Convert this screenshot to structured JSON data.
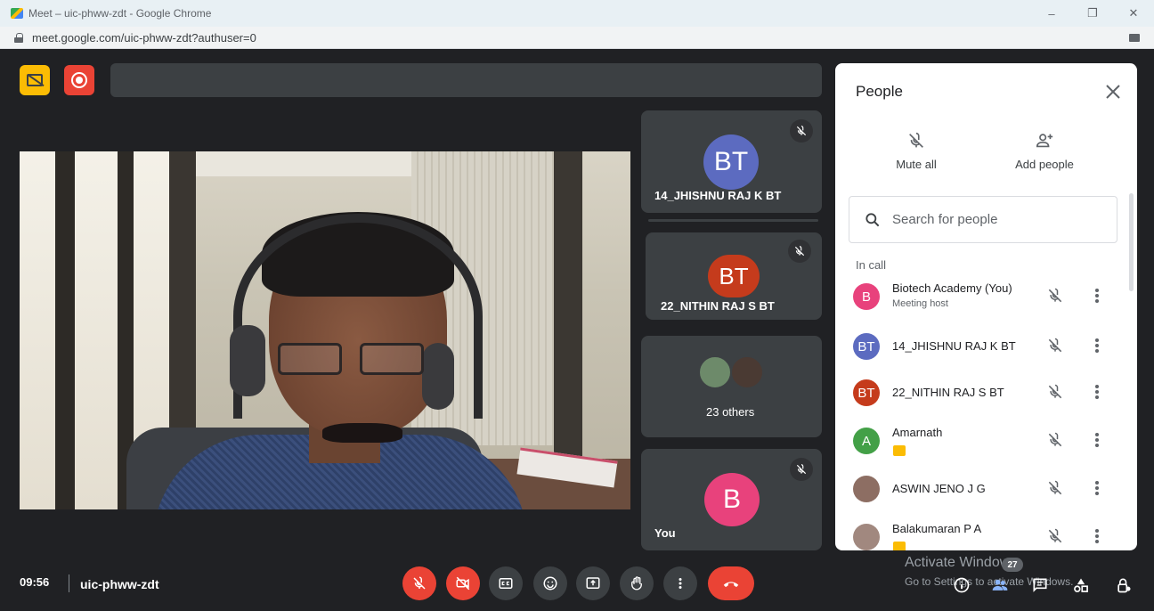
{
  "window": {
    "title": "Meet – uic-phww-zdt - Google Chrome",
    "url": "meet.google.com/uic-phww-zdt?authuser=0",
    "controls": [
      "–",
      "❐",
      "✕"
    ]
  },
  "tiles": [
    {
      "initials": "BT",
      "name": "14_JHISHNU RAJ K BT",
      "avatar_color": "#5c6bc0",
      "muted": true
    },
    {
      "initials": "BT",
      "name": "22_NITHIN RAJ S BT",
      "avatar_color": "#c53b1c",
      "muted": true
    },
    {
      "name": "23 others"
    },
    {
      "initials": "B",
      "name": "You",
      "avatar_color": "#e8427c",
      "muted": true
    }
  ],
  "bottom": {
    "time": "09:56",
    "meeting_code": "uic-phww-zdt",
    "participants_badge": "27"
  },
  "watermark": {
    "line1": "Activate Windows",
    "line2": "Go to Settings to activate Windows."
  },
  "people": {
    "title": "People",
    "mute_all": "Mute all",
    "add_people": "Add people",
    "search_placeholder": "Search for people",
    "section": "In call",
    "participants": [
      {
        "initials": "B",
        "name": "Biotech Academy (You)",
        "subtitle": "Meeting host",
        "color": "#e8427c"
      },
      {
        "initials": "BT",
        "name": "14_JHISHNU RAJ K BT",
        "color": "#5c6bc0"
      },
      {
        "initials": "BT",
        "name": "22_NITHIN RAJ S BT",
        "color": "#c53b1c"
      },
      {
        "initials": "A",
        "name": "Amarnath",
        "color": "#43a047",
        "presenting": true
      },
      {
        "initials": "",
        "name": "ASWIN JENO J G",
        "color": "#8d6e63"
      },
      {
        "initials": "",
        "name": "Balakumaran P A",
        "color": "#a1887f",
        "presenting": true
      }
    ]
  },
  "colors": {
    "meet_bg": "#202124",
    "tile_bg": "#3c4043",
    "danger": "#ea4335",
    "warning": "#fbbc04"
  }
}
